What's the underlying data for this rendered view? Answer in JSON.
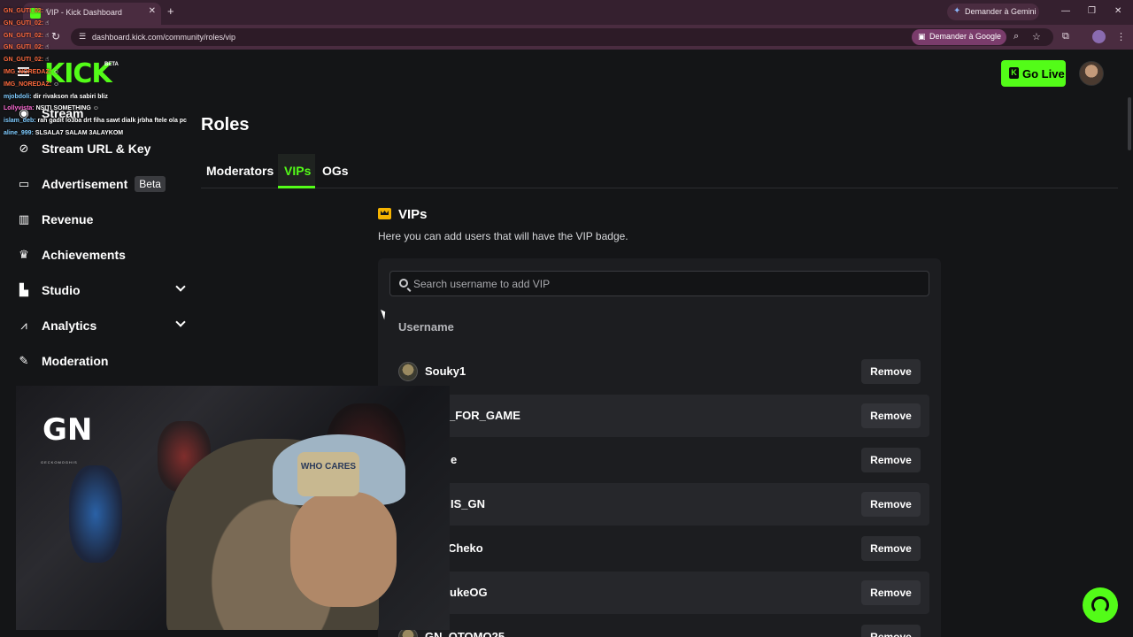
{
  "browser": {
    "tab_title": "VIP - Kick Dashboard",
    "tab_close": "✕",
    "new_tab": "+",
    "url": "dashboard.kick.com/community/roles/vip",
    "gemini_label": "Demander à Gemini",
    "google_label": "Demander à Google"
  },
  "header": {
    "logo": "KICK",
    "beta": "BETA",
    "go_live_label": "Go Live"
  },
  "chat_overlay": [
    {
      "user": "GN_GUTI_02:",
      "msg": " ☝"
    },
    {
      "user": "GN_GUTI_02:",
      "msg": " ☝"
    },
    {
      "user": "GN_GUTI_02:",
      "msg": " ☝"
    },
    {
      "user": "GN_GUTI_02:",
      "msg": " ☝"
    },
    {
      "user": "GN_GUTI_02:",
      "msg": " ☝"
    },
    {
      "user": "IMG_NOREDAZ:",
      "msg": " ☺"
    },
    {
      "user": "IMG_NOREDAZ:",
      "msg": " ☺"
    },
    {
      "user": "mjobdoli:",
      "msg": " dir rivakson rla sabiri bliz"
    },
    {
      "user": "Lollyvista:",
      "msg": " NSITI SOMETHING ☺"
    },
    {
      "user": "islam_deb:",
      "msg": " rah gadit lo3ba drt fiha sawt dialk jrbha ftele ola pc"
    },
    {
      "user": "aline_999:",
      "msg": " SLSALA7 SALAM 3ALAYKOM"
    }
  ],
  "sidebar": {
    "items": [
      {
        "label": "Stream",
        "icon": "broadcast-icon"
      },
      {
        "label": "Stream URL & Key",
        "icon": "link-icon"
      },
      {
        "label": "Advertisement",
        "icon": "ad-icon",
        "badge": "Beta"
      },
      {
        "label": "Revenue",
        "icon": "chart-bars-icon"
      },
      {
        "label": "Achievements",
        "icon": "trophy-icon"
      },
      {
        "label": "Studio",
        "icon": "studio-icon"
      },
      {
        "label": "Analytics",
        "icon": "analytics-icon"
      },
      {
        "label": "Moderation",
        "icon": "wrench-icon"
      }
    ]
  },
  "webcam": {
    "logo": "GN",
    "logo_sub": "GECKOMOGHIS",
    "cap_text": "WHO CARES"
  },
  "main": {
    "title": "Roles",
    "tabs": [
      {
        "label": "Moderators"
      },
      {
        "label": "VIPs"
      },
      {
        "label": "OGs"
      }
    ],
    "section_title": "VIPs",
    "section_desc": "Here you can add users that will have the VIP badge.",
    "search_placeholder": "Search username to add VIP",
    "column_header": "Username",
    "remove_label": "Remove",
    "vips": [
      "Souky1",
      "_FOR_GAME",
      "e",
      "IS_GN",
      "Cheko",
      "ukeOG",
      "GN_OTOMO25"
    ]
  }
}
